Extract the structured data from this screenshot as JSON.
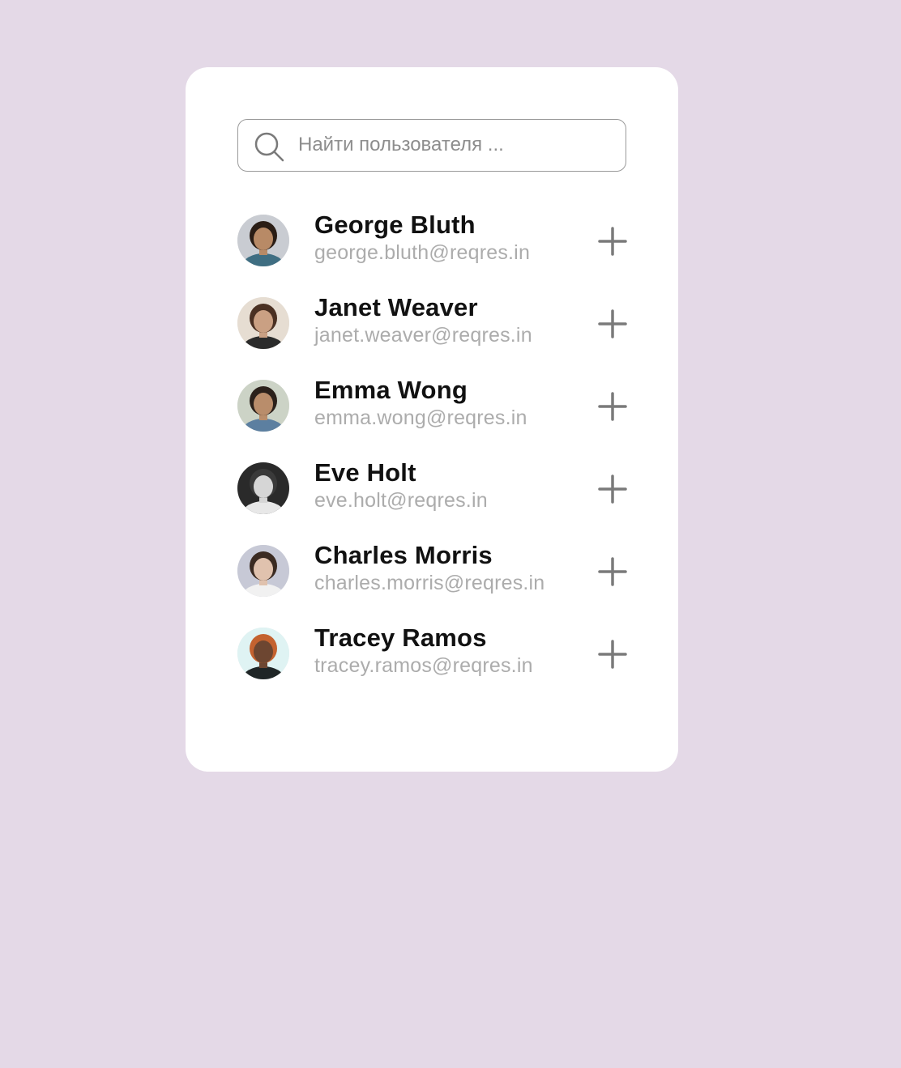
{
  "search": {
    "placeholder": "Найти пользователя ...",
    "icon": "search-icon"
  },
  "users": [
    {
      "name": "George Bluth",
      "email": "george.bluth@reqres.in",
      "avatar_colors": {
        "bg": "#c9ccd2",
        "skin": "#b88a66",
        "hair": "#2a1d15",
        "shirt": "#3f6e82"
      }
    },
    {
      "name": "Janet Weaver",
      "email": "janet.weaver@reqres.in",
      "avatar_colors": {
        "bg": "#e6ddd2",
        "skin": "#caa083",
        "hair": "#4a3022",
        "shirt": "#2b2b2b"
      }
    },
    {
      "name": "Emma Wong",
      "email": "emma.wong@reqres.in",
      "avatar_colors": {
        "bg": "#ccd3c6",
        "skin": "#b98d6b",
        "hair": "#2b211b",
        "shirt": "#5c7fa0"
      }
    },
    {
      "name": "Eve Holt",
      "email": "eve.holt@reqres.in",
      "avatar_colors": {
        "bg": "#2a2a2a",
        "skin": "#d6d6d6",
        "hair": "#3a3a3a",
        "shirt": "#e8e8e8"
      }
    },
    {
      "name": "Charles Morris",
      "email": "charles.morris@reqres.in",
      "avatar_colors": {
        "bg": "#c7c9d6",
        "skin": "#e0c2ae",
        "hair": "#3b2b22",
        "shirt": "#f1f1f1"
      }
    },
    {
      "name": "Tracey Ramos",
      "email": "tracey.ramos@reqres.in",
      "avatar_colors": {
        "bg": "#dff3f3",
        "skin": "#6d4631",
        "hair": "#c4622f",
        "shirt": "#1f2526"
      }
    }
  ],
  "add_icon": "plus-icon",
  "colors": {
    "page_background": "#e4d9e7",
    "card_background": "#ffffff",
    "name_text": "#111111",
    "email_text": "#acacac",
    "icon_gray": "#7a7a7a"
  }
}
